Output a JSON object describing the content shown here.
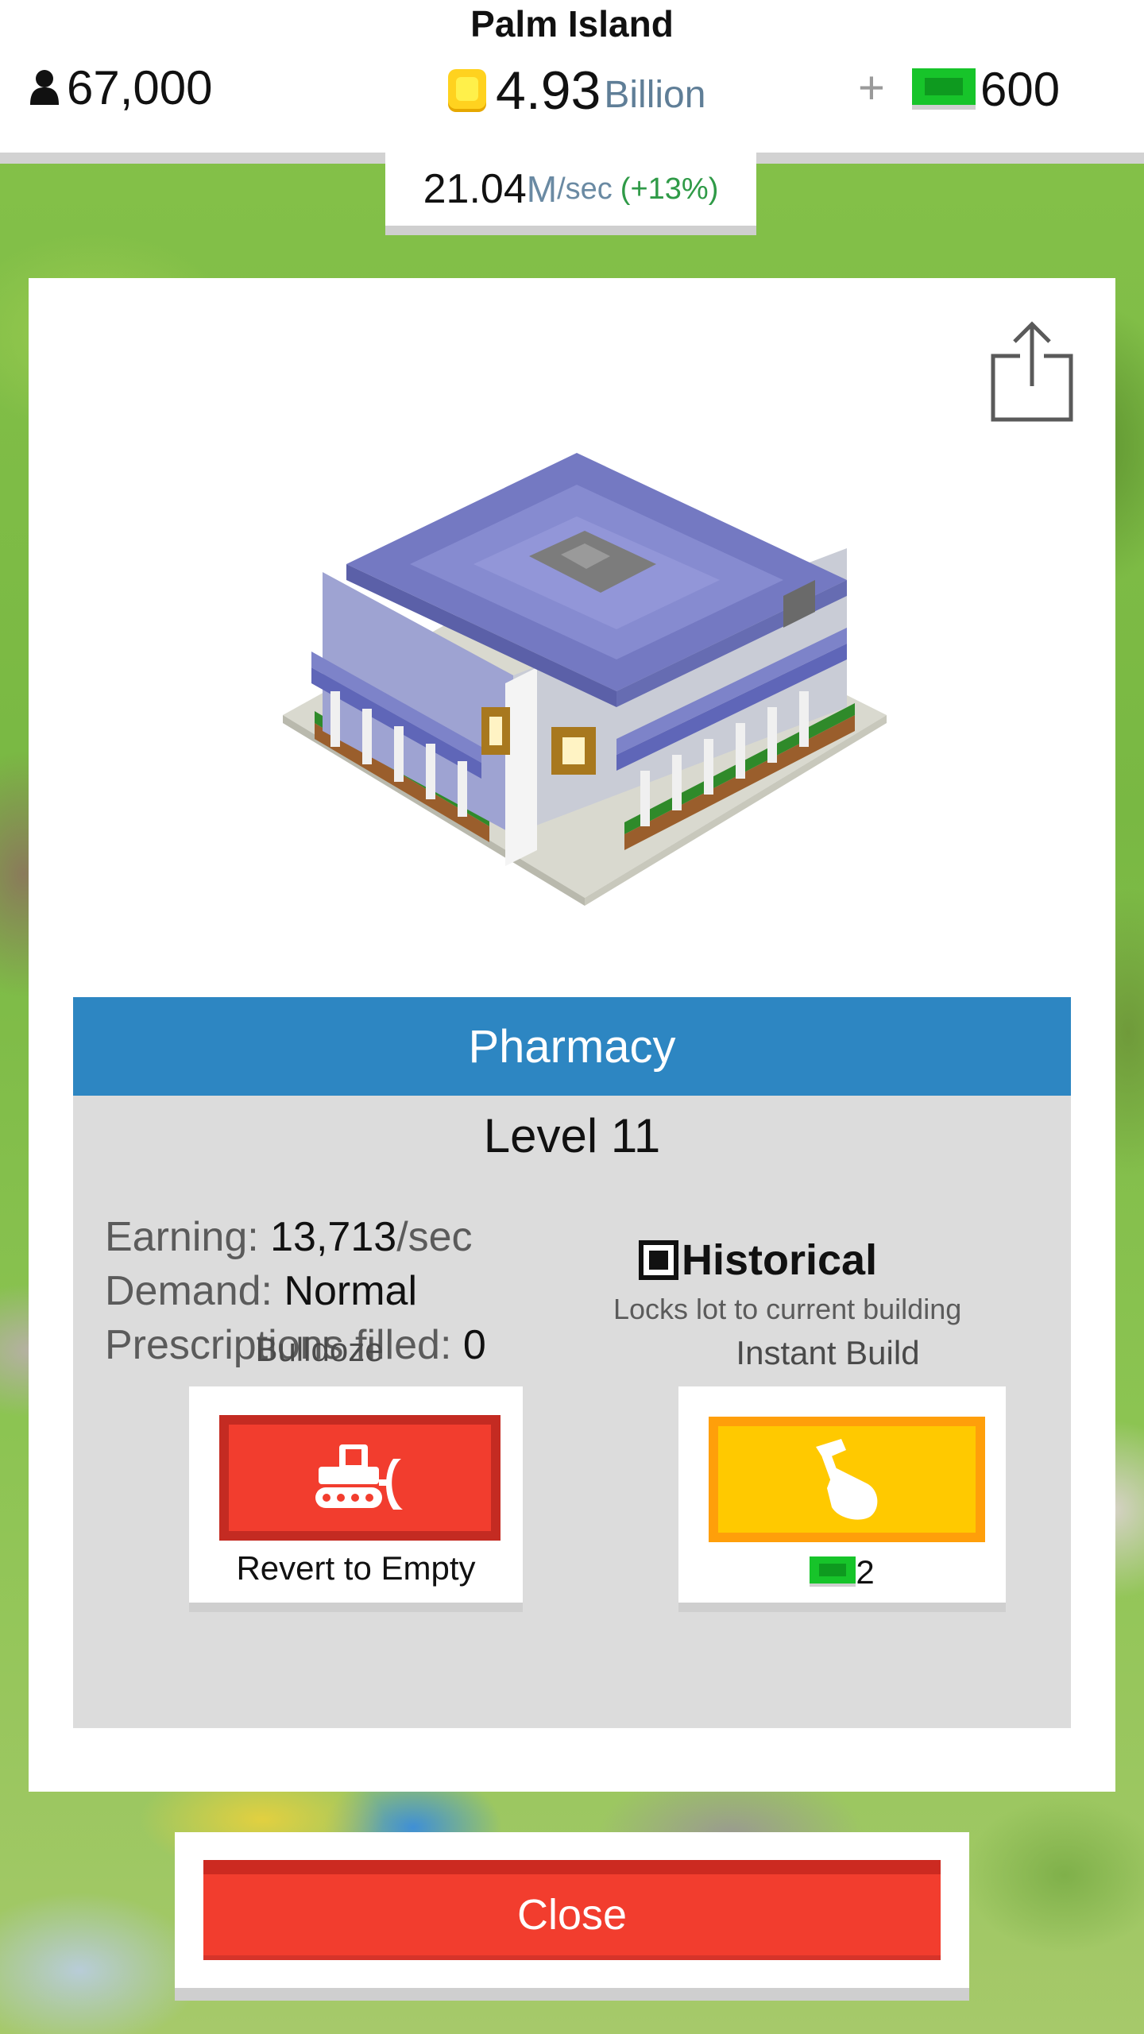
{
  "hud": {
    "city_name": "Palm Island",
    "population": "67,000",
    "money_value": "4.93",
    "money_unit": "Billion",
    "plus": "+",
    "cash_value": "600"
  },
  "income": {
    "rate": "21.04",
    "unit": "M",
    "per": "/sec",
    "bonus": "(+13%)"
  },
  "building": {
    "name": "Pharmacy",
    "level": "Level 11",
    "stats": [
      {
        "label": "Earning: ",
        "value": "13,713",
        "unit": "/sec"
      },
      {
        "label": "Demand: ",
        "value": "Normal",
        "unit": ""
      },
      {
        "label": "Prescriptions filled: ",
        "value": "0",
        "unit": ""
      }
    ],
    "historical": {
      "label": "Historical",
      "description": "Locks lot to current building",
      "checked": true
    }
  },
  "actions": {
    "bulldoze_label": "Bulldoze",
    "bulldoze_caption": "Revert to Empty",
    "instant_build_label": "Instant Build",
    "instant_build_cost": "2"
  },
  "close_label": "Close",
  "icons": {
    "population": "person-icon",
    "money": "coin-icon",
    "cash": "cash-icon",
    "share": "share-icon",
    "bulldozer": "bulldozer-icon",
    "hammer": "hammer-hand-icon"
  },
  "colors": {
    "header_blue": "#2d86c2",
    "bulldoze_red": "#f23d2e",
    "build_yellow": "#ffc900",
    "cash_green": "#17c42a",
    "bonus_green": "#2f9a47"
  }
}
